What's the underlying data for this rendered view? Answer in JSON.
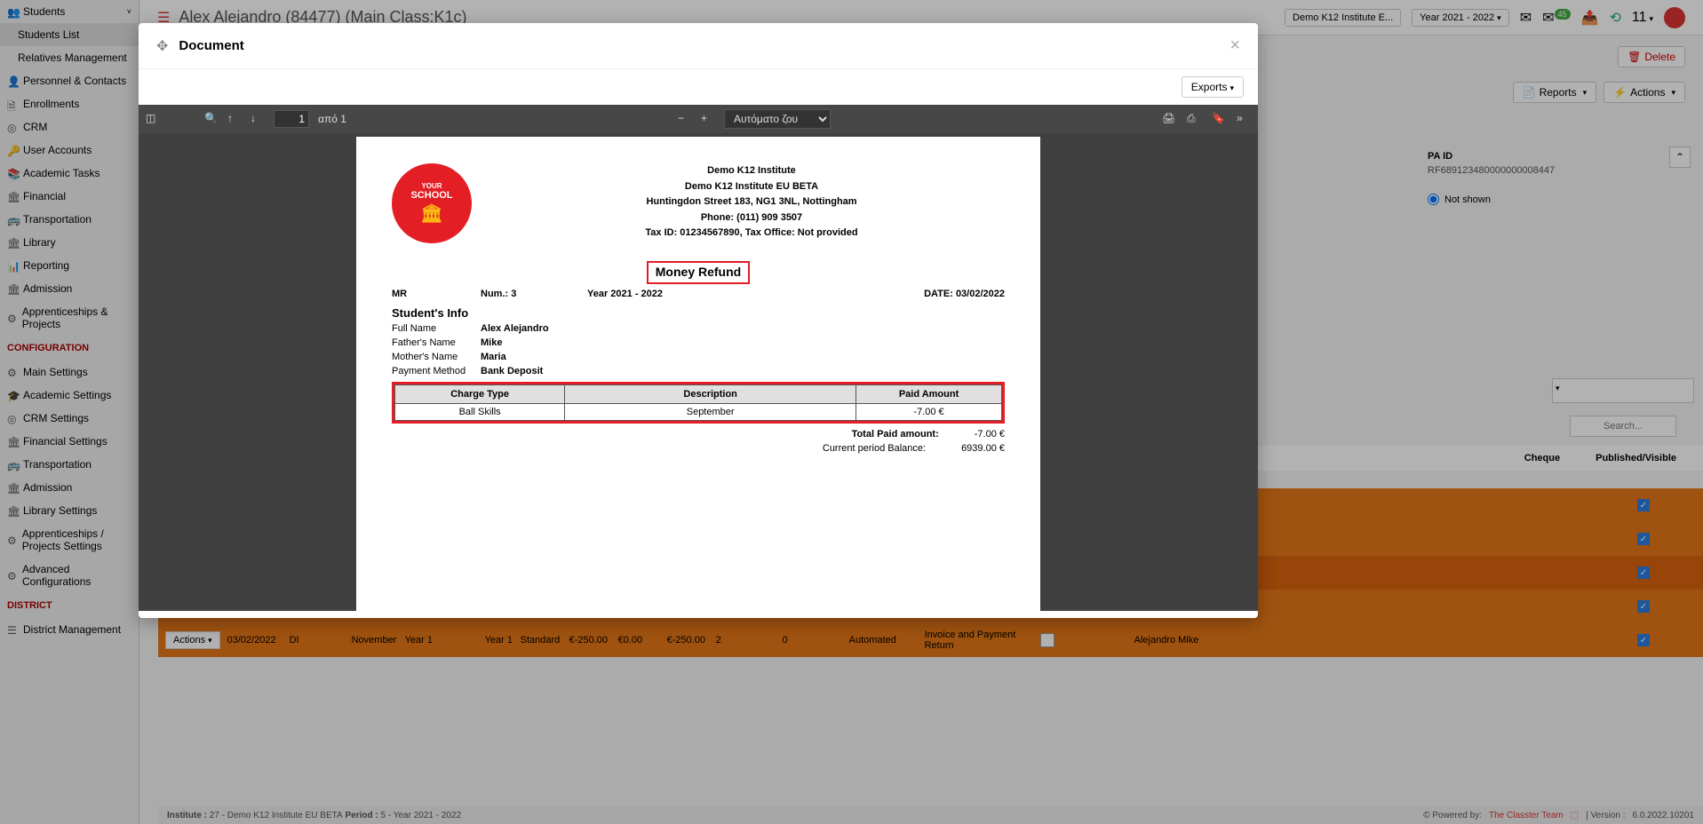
{
  "sidebar": {
    "students": "Students",
    "students_list": "Students List",
    "relatives": "Relatives Management",
    "personnel": "Personnel & Contacts",
    "enrollments": "Enrollments",
    "crm": "CRM",
    "user_accounts": "User Accounts",
    "academic_tasks": "Academic Tasks",
    "financial": "Financial",
    "transportation": "Transportation",
    "library": "Library",
    "reporting": "Reporting",
    "admission": "Admission",
    "apprenticeships": "Apprenticeships & Projects",
    "config_header": "CONFIGURATION",
    "main_settings": "Main Settings",
    "academic_settings": "Academic Settings",
    "crm_settings": "CRM Settings",
    "financial_settings": "Financial Settings",
    "transportation2": "Transportation",
    "admission2": "Admission",
    "library_settings": "Library Settings",
    "apprenticeships_settings": "Apprenticeships / Projects Settings",
    "advanced_config": "Advanced Configurations",
    "district_header": "DISTRICT",
    "district_mgmt": "District Management"
  },
  "header": {
    "title": "Alex Alejandro (84477) (Main Class:K1c)",
    "institute": "Demo K12 Institute E...",
    "year": "Year 2021 - 2022",
    "badge": "45",
    "count": "11"
  },
  "buttons": {
    "delete": "Delete",
    "reports": "Reports",
    "actions": "Actions",
    "exports": "Exports"
  },
  "modal": {
    "title": "Document"
  },
  "pdf_toolbar": {
    "page_value": "1",
    "page_of": "από 1",
    "zoom": "Αυτόματο ζουμ"
  },
  "document": {
    "logo": {
      "line1": "YOUR",
      "line2": "SCHOOL"
    },
    "org_line1": "Demo K12 Institute",
    "org_line2": "Demo K12 Institute EU BETA",
    "address": "Huntingdon Street 183, NG1 3NL, Nottingham",
    "phone": "Phone: (011) 909 3507",
    "tax": "Tax ID: 01234567890, Tax Office: Not provided",
    "title": "Money Refund",
    "mr": "MR",
    "num_label": "Num.:",
    "num": "3",
    "year": "Year 2021 - 2022",
    "date_label": "DATE:",
    "date": "03/02/2022",
    "student_info": "Student's Info",
    "fullname_label": "Full Name",
    "fullname": "Alex Alejandro",
    "father_label": "Father's Name",
    "father": "Mike",
    "mother_label": "Mother's Name",
    "mother": "Maria",
    "payment_label": "Payment Method",
    "payment": "Bank Deposit",
    "th1": "Charge Type",
    "th2": "Description",
    "th3": "Paid Amount",
    "td1": "Ball Skills",
    "td2": "September",
    "td3": "-7.00 €",
    "total_label": "Total Paid amount:",
    "total": "-7.00 €",
    "balance_label": "Current period Balance:",
    "balance": "6939.00 €"
  },
  "right_panel": {
    "pa_id_label": "PA ID",
    "pa_id": "RF689123480000000008447",
    "not_shown": "Not shown"
  },
  "bg_table": {
    "cheque": "Cheque",
    "published": "Published/Visible",
    "search": "Search..."
  },
  "bg_row": {
    "actions": "Actions",
    "date": "03/02/2022",
    "di": "DI",
    "month": "November",
    "year": "Year 1",
    "year1": "Year 1",
    "standard": "Standard",
    "amt1": "€-250.00",
    "amt2": "€0.00",
    "amt3": "€-250.00",
    "two": "2",
    "zero": "0",
    "automated": "Automated",
    "invoice": "Invoice and Payment Return",
    "name": "Alejandro Mike"
  },
  "footer": {
    "institute_label": "Institute :",
    "institute": "27 - Demo K12 Institute EU BETA",
    "period_label": "Period :",
    "period": "5 - Year 2021 - 2022",
    "powered": "Powered by:",
    "team": "The Classter Team",
    "version_label": "| Version :",
    "version": "6.0.2022.10201"
  }
}
